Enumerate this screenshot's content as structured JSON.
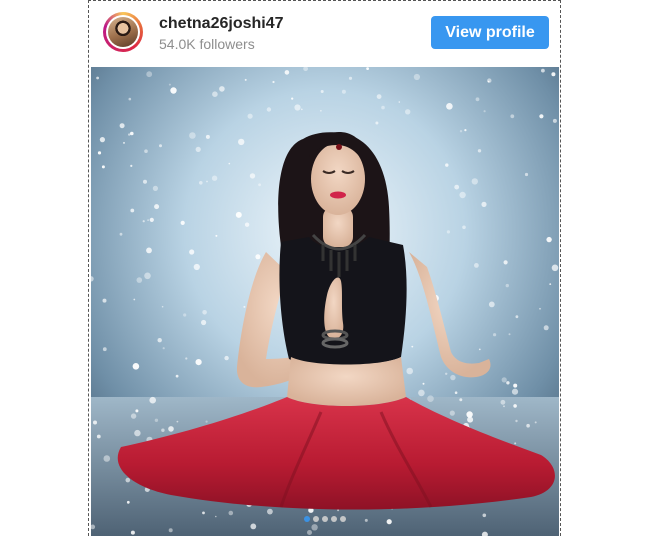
{
  "profile": {
    "username": "chetna26joshi47",
    "followers": "54.0K followers",
    "view_profile_label": "View profile"
  },
  "post": {
    "carousel_dots": 5,
    "carousel_active_index": 0
  },
  "colors": {
    "button": "#3897f0",
    "username": "#262626",
    "followers": "#8e8e8e",
    "skirt": "#c41e3a"
  }
}
